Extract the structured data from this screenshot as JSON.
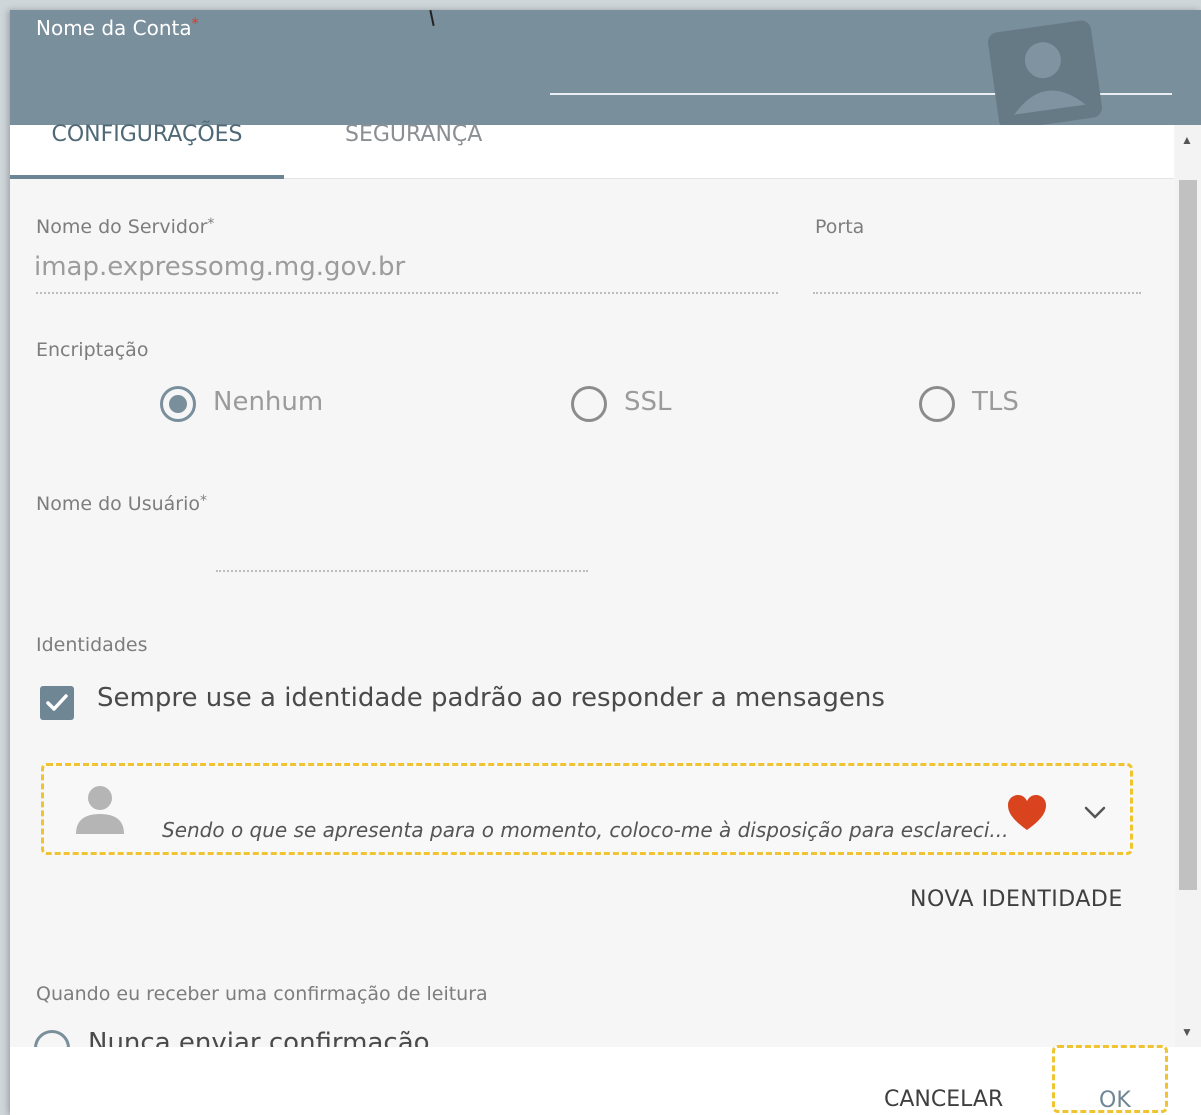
{
  "header": {
    "account_label": "Nome da Conta",
    "required_mark": "*",
    "account_value": ""
  },
  "tabs": [
    {
      "label": "CONFIGURAÇÕES",
      "active": true
    },
    {
      "label": "SEGURANÇA",
      "active": false
    }
  ],
  "server": {
    "label": "Nome do Servidor",
    "required_mark": "*",
    "value": "imap.expressomg.mg.gov.br"
  },
  "port": {
    "label": "Porta",
    "value": ""
  },
  "encryption": {
    "label": "Encriptação",
    "options": [
      {
        "label": "Nenhum",
        "selected": true
      },
      {
        "label": "SSL",
        "selected": false
      },
      {
        "label": "TLS",
        "selected": false
      }
    ]
  },
  "username": {
    "label": "Nome do Usuário",
    "required_mark": "*",
    "value": ""
  },
  "identities": {
    "label": "Identidades",
    "always_default_label": "Sempre use a identidade padrão ao responder a mensagens",
    "always_default_checked": true,
    "item": {
      "signature": "Sendo o que se apresenta para o momento, coloco-me à disposição para esclareci...",
      "favorite": true
    },
    "new_identity_label": "NOVA IDENTIDADE"
  },
  "read_receipt": {
    "label": "Quando eu receber uma confirmação de leitura",
    "option_partial": "Nunca enviar confirmação"
  },
  "footer": {
    "cancel_label": "CANCELAR",
    "ok_label": "OK"
  },
  "colors": {
    "header_bg": "#7a8f9c",
    "accent": "#6f8695",
    "favorite": "#d9431e",
    "highlight": "#f0c431"
  }
}
